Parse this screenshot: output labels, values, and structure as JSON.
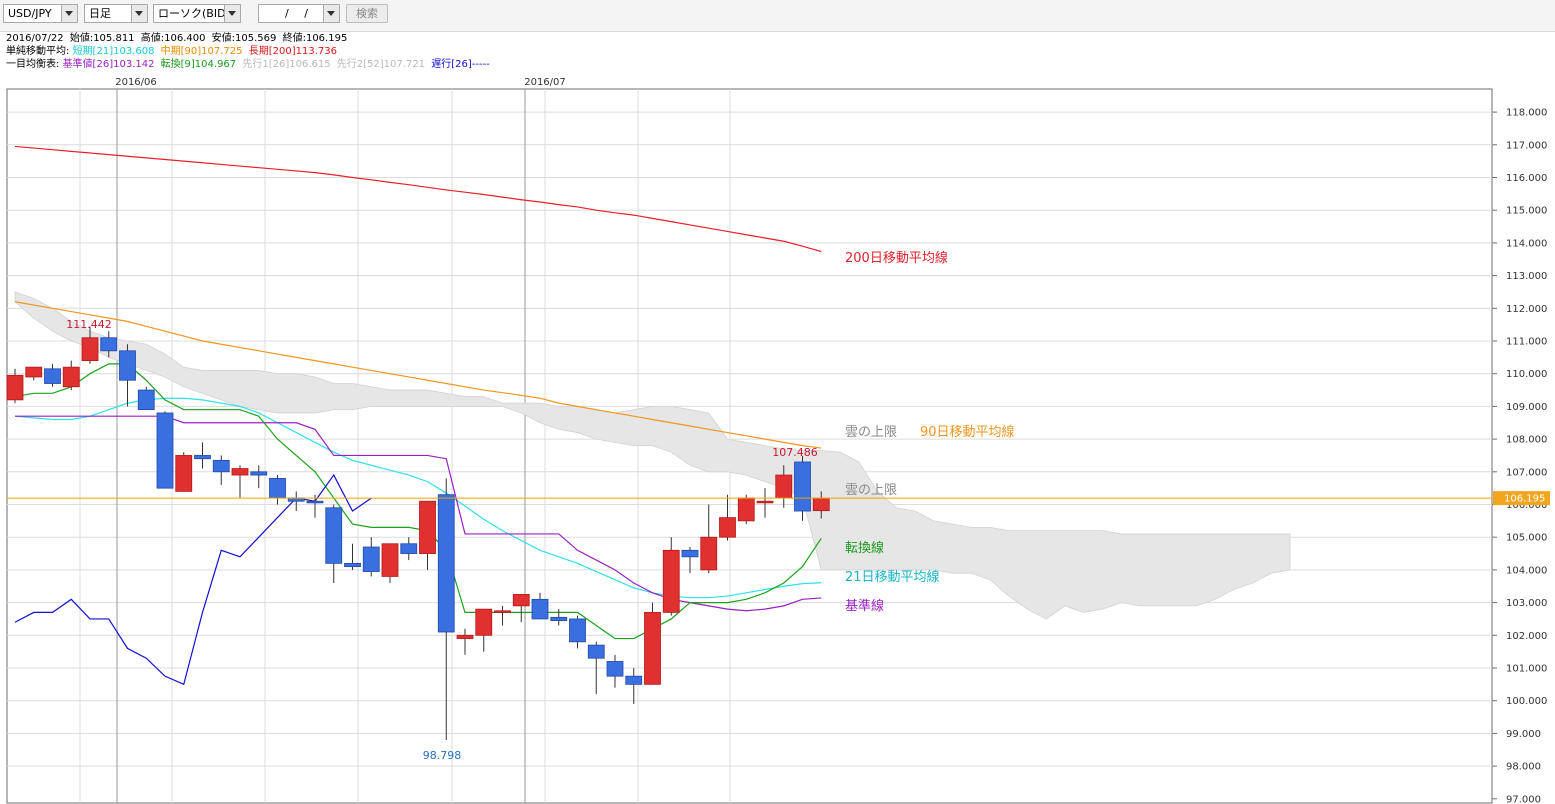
{
  "toolbar": {
    "pair": "USD/JPY",
    "period": "日足",
    "chart_type": "ローソク(BID)",
    "date": "/ /",
    "search_label": "検索"
  },
  "info": {
    "ohlc": {
      "date": "2016/07/22",
      "open": "始値:105.811",
      "high": "高値:106.400",
      "low": "安値:105.569",
      "close": "終値:106.195"
    },
    "sma_label": "単純移動平均:",
    "sma_short": "短期[21]103.608",
    "sma_mid": "中期[90]107.725",
    "sma_long": "長期[200]113.736",
    "ichimoku_label": "一目均衡表:",
    "kijun": "基準値[26]103.142",
    "tenkan": "転換[9]104.967",
    "senkou1": "先行1[26]106.615",
    "senkou2": "先行2[52]107.721",
    "chikou": "遅行[26]-----"
  },
  "colors": {
    "up": "#e03030",
    "down": "#3a6fe0",
    "sma200": "#e8202a",
    "sma90": "#f0961e",
    "sma21": "#2ee0ea",
    "tenkan": "#1aa21a",
    "kijun": "#9a20c4",
    "chikou": "#1010d0",
    "cloud": "#e6e6e6",
    "price_line": "#f0a500"
  },
  "chart_data": {
    "type": "candlestick",
    "xlabels": [
      "2016/06",
      "2016/07"
    ],
    "yticks": [
      "97.000",
      "98.000",
      "99.000",
      "100.000",
      "101.000",
      "102.000",
      "103.000",
      "104.000",
      "105.000",
      "106.000",
      "107.000",
      "108.000",
      "109.000",
      "110.000",
      "111.000",
      "112.000",
      "113.000",
      "114.000",
      "115.000",
      "116.000",
      "117.000",
      "118.000"
    ],
    "ylim": [
      97,
      119
    ],
    "current_price": 106.195,
    "current_price_label": "106.195",
    "candles": [
      {
        "o": 109.2,
        "h": 110.15,
        "l": 109.1,
        "c": 109.95
      },
      {
        "o": 109.9,
        "h": 110.2,
        "l": 109.8,
        "c": 110.2
      },
      {
        "o": 110.15,
        "h": 110.3,
        "l": 109.6,
        "c": 109.7
      },
      {
        "o": 109.6,
        "h": 110.4,
        "l": 109.5,
        "c": 110.2
      },
      {
        "o": 110.4,
        "h": 111.442,
        "l": 110.3,
        "c": 111.1
      },
      {
        "o": 111.1,
        "h": 111.3,
        "l": 110.5,
        "c": 110.7
      },
      {
        "o": 110.7,
        "h": 110.9,
        "l": 109.0,
        "c": 109.8
      },
      {
        "o": 109.5,
        "h": 109.6,
        "l": 108.9,
        "c": 108.9
      },
      {
        "o": 108.8,
        "h": 108.85,
        "l": 106.5,
        "c": 106.5
      },
      {
        "o": 106.4,
        "h": 107.6,
        "l": 106.4,
        "c": 107.5
      },
      {
        "o": 107.5,
        "h": 107.9,
        "l": 107.1,
        "c": 107.4
      },
      {
        "o": 107.35,
        "h": 107.5,
        "l": 106.6,
        "c": 107.0
      },
      {
        "o": 106.9,
        "h": 107.2,
        "l": 106.2,
        "c": 107.1
      },
      {
        "o": 107.0,
        "h": 107.2,
        "l": 106.5,
        "c": 106.9
      },
      {
        "o": 106.8,
        "h": 106.9,
        "l": 106.0,
        "c": 106.2
      },
      {
        "o": 106.2,
        "h": 106.4,
        "l": 105.8,
        "c": 106.1
      },
      {
        "o": 106.1,
        "h": 106.3,
        "l": 105.6,
        "c": 106.05
      },
      {
        "o": 105.9,
        "h": 106.0,
        "l": 103.6,
        "c": 104.2
      },
      {
        "o": 104.2,
        "h": 104.8,
        "l": 104.0,
        "c": 104.1
      },
      {
        "o": 104.7,
        "h": 105.0,
        "l": 103.8,
        "c": 103.95
      },
      {
        "o": 103.8,
        "h": 104.8,
        "l": 103.6,
        "c": 104.8
      },
      {
        "o": 104.8,
        "h": 105.0,
        "l": 104.3,
        "c": 104.5
      },
      {
        "o": 104.5,
        "h": 106.0,
        "l": 104.0,
        "c": 106.1
      },
      {
        "o": 106.3,
        "h": 106.8,
        "l": 98.798,
        "c": 102.1
      },
      {
        "o": 101.9,
        "h": 102.2,
        "l": 101.4,
        "c": 102.0
      },
      {
        "o": 102.0,
        "h": 102.8,
        "l": 101.5,
        "c": 102.8
      },
      {
        "o": 102.7,
        "h": 102.9,
        "l": 102.3,
        "c": 102.75
      },
      {
        "o": 102.9,
        "h": 103.25,
        "l": 102.4,
        "c": 103.25
      },
      {
        "o": 103.1,
        "h": 103.3,
        "l": 102.5,
        "c": 102.5
      },
      {
        "o": 102.55,
        "h": 102.8,
        "l": 102.3,
        "c": 102.45
      },
      {
        "o": 102.5,
        "h": 102.6,
        "l": 101.6,
        "c": 101.8
      },
      {
        "o": 101.7,
        "h": 101.8,
        "l": 100.2,
        "c": 101.3
      },
      {
        "o": 101.2,
        "h": 101.4,
        "l": 100.4,
        "c": 100.75
      },
      {
        "o": 100.75,
        "h": 101.0,
        "l": 99.9,
        "c": 100.5
      },
      {
        "o": 100.5,
        "h": 103.0,
        "l": 100.5,
        "c": 102.7
      },
      {
        "o": 102.7,
        "h": 105.0,
        "l": 102.6,
        "c": 104.6
      },
      {
        "o": 104.6,
        "h": 104.7,
        "l": 103.9,
        "c": 104.4
      },
      {
        "o": 104.0,
        "h": 106.0,
        "l": 103.9,
        "c": 105.0
      },
      {
        "o": 105.0,
        "h": 106.3,
        "l": 104.9,
        "c": 105.6
      },
      {
        "o": 105.5,
        "h": 106.3,
        "l": 105.4,
        "c": 106.2
      },
      {
        "o": 106.05,
        "h": 106.5,
        "l": 105.6,
        "c": 106.1
      },
      {
        "o": 106.2,
        "h": 107.2,
        "l": 105.9,
        "c": 106.9
      },
      {
        "o": 107.3,
        "h": 107.486,
        "l": 105.5,
        "c": 105.8
      },
      {
        "o": 105.811,
        "h": 106.4,
        "l": 105.569,
        "c": 106.195
      }
    ],
    "series": {
      "sma200": [
        116.95,
        116.9,
        116.85,
        116.8,
        116.75,
        116.7,
        116.65,
        116.6,
        116.55,
        116.5,
        116.45,
        116.4,
        116.35,
        116.3,
        116.25,
        116.2,
        116.15,
        116.08,
        116.0,
        115.93,
        115.85,
        115.78,
        115.7,
        115.62,
        115.55,
        115.48,
        115.4,
        115.32,
        115.25,
        115.17,
        115.1,
        115.0,
        114.92,
        114.85,
        114.75,
        114.65,
        114.55,
        114.45,
        114.35,
        114.25,
        114.15,
        114.05,
        113.9,
        113.736
      ],
      "sma90": [
        112.2,
        112.1,
        112.0,
        111.9,
        111.8,
        111.7,
        111.6,
        111.45,
        111.3,
        111.15,
        111.0,
        110.9,
        110.8,
        110.7,
        110.6,
        110.5,
        110.4,
        110.3,
        110.2,
        110.1,
        110.0,
        109.9,
        109.8,
        109.7,
        109.6,
        109.5,
        109.42,
        109.34,
        109.25,
        109.1,
        109.0,
        108.9,
        108.8,
        108.7,
        108.6,
        108.5,
        108.4,
        108.3,
        108.2,
        108.1,
        108.0,
        107.9,
        107.8,
        107.725
      ],
      "sma21": [
        108.7,
        108.65,
        108.6,
        108.6,
        108.7,
        108.9,
        109.1,
        109.2,
        109.25,
        109.25,
        109.2,
        109.1,
        109.0,
        108.8,
        108.5,
        108.2,
        107.9,
        107.6,
        107.35,
        107.2,
        107.05,
        106.9,
        106.7,
        106.35,
        105.95,
        105.55,
        105.2,
        104.9,
        104.6,
        104.4,
        104.2,
        103.95,
        103.7,
        103.45,
        103.3,
        103.2,
        103.15,
        103.15,
        103.2,
        103.3,
        103.4,
        103.5,
        103.58,
        103.608
      ],
      "tenkan": [
        109.3,
        109.4,
        109.4,
        109.6,
        110.0,
        110.3,
        110.3,
        109.8,
        109.2,
        108.9,
        108.9,
        108.9,
        108.9,
        108.7,
        108.0,
        107.5,
        107.0,
        106.2,
        105.4,
        105.3,
        105.3,
        105.3,
        105.2,
        104.6,
        102.7,
        102.7,
        102.7,
        102.7,
        102.7,
        102.7,
        102.7,
        102.3,
        101.9,
        101.9,
        102.2,
        102.5,
        103.0,
        103.0,
        103.0,
        103.1,
        103.3,
        103.6,
        104.1,
        104.967
      ],
      "kijun": [
        108.7,
        108.7,
        108.7,
        108.7,
        108.7,
        108.7,
        108.7,
        108.7,
        108.7,
        108.5,
        108.5,
        108.5,
        108.5,
        108.5,
        108.5,
        108.5,
        108.3,
        107.5,
        107.5,
        107.5,
        107.5,
        107.5,
        107.5,
        107.4,
        105.1,
        105.1,
        105.1,
        105.1,
        105.1,
        105.1,
        104.6,
        104.3,
        104.0,
        103.6,
        103.3,
        103.1,
        103.0,
        102.9,
        102.8,
        102.75,
        102.8,
        102.9,
        103.1,
        103.142
      ],
      "chikou": [
        102.4,
        102.7,
        102.7,
        103.1,
        102.5,
        102.5,
        101.6,
        101.3,
        100.75,
        100.5,
        102.7,
        104.6,
        104.4,
        105.0,
        105.6,
        106.2,
        106.1,
        106.9,
        105.8,
        106.195
      ],
      "cloud_top": [
        112.5,
        112.3,
        112.0,
        111.6,
        111.3,
        111.1,
        111.0,
        110.9,
        110.6,
        110.2,
        110.1,
        110.1,
        110.1,
        110.1,
        110.0,
        110.0,
        109.9,
        109.7,
        109.7,
        109.6,
        109.5,
        109.5,
        109.5,
        109.4,
        109.3,
        109.3,
        109.1,
        109.1,
        109.1,
        109.0,
        109.0,
        108.9,
        108.8,
        108.9,
        109.0,
        109.0,
        108.9,
        108.8,
        108.0,
        107.9,
        107.8,
        107.7,
        107.65,
        107.65,
        107.6,
        107.3,
        106.4,
        105.9,
        105.8,
        105.5,
        105.4,
        105.3,
        105.3,
        105.2,
        105.2,
        105.2,
        105.2,
        105.2,
        105.2,
        105.1,
        105.1,
        105.1,
        105.1,
        105.1,
        105.1,
        105.1,
        105.1,
        105.1,
        105.1
      ],
      "cloud_bottom": [
        112.2,
        111.7,
        111.3,
        111.0,
        110.8,
        110.5,
        110.3,
        110.1,
        109.9,
        109.6,
        109.4,
        109.2,
        109.0,
        108.9,
        108.8,
        108.8,
        108.8,
        108.9,
        108.9,
        109.0,
        109.0,
        109.0,
        109.0,
        109.0,
        109.0,
        109.0,
        109.0,
        108.8,
        108.5,
        108.3,
        108.2,
        108.0,
        107.9,
        107.8,
        107.8,
        107.6,
        107.2,
        107.0,
        107.0,
        106.9,
        106.7,
        106.5,
        106.2,
        104.0,
        104.0,
        104.0,
        104.0,
        104.0,
        104.0,
        104.0,
        103.9,
        103.9,
        103.7,
        103.2,
        102.8,
        102.5,
        102.9,
        102.7,
        102.8,
        103.0,
        102.9,
        102.9,
        102.9,
        102.9,
        103.1,
        103.4,
        103.6,
        103.9,
        104.0
      ]
    },
    "annotations": {
      "high_label": "111.442",
      "low_label": "98.798",
      "recent_high_label": "107.486",
      "sma200_label": "200日移動平均線",
      "cloud_upper_label": "雲の上限",
      "sma90_label": "90日移動平均線",
      "cloud_upper_label2": "雲の上限",
      "tenkan_label": "転換線",
      "sma21_label": "21日移動平均線",
      "kijun_label": "基準線"
    }
  }
}
